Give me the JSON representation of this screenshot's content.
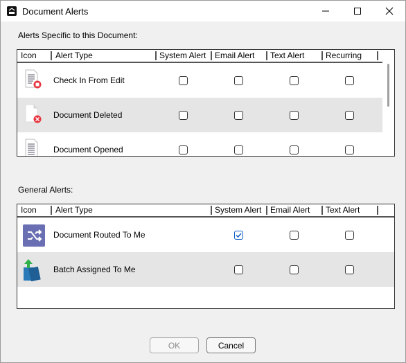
{
  "window": {
    "title": "Document Alerts",
    "icon": "spc-app-icon"
  },
  "specific": {
    "label": "Alerts Specific to this Document:",
    "columns": [
      "Icon",
      "Alert Type",
      "System Alert",
      "Email Alert",
      "Text Alert",
      "Recurring"
    ],
    "rows": [
      {
        "alert_type": "Check In From Edit",
        "icon": "document-error-icon",
        "system": false,
        "email": false,
        "text": false,
        "recurring": false
      },
      {
        "alert_type": "Document Deleted",
        "icon": "document-deleted-icon",
        "system": false,
        "email": false,
        "text": false,
        "recurring": false
      },
      {
        "alert_type": "Document Opened",
        "icon": "document-lines-icon",
        "system": false,
        "email": false,
        "text": false,
        "recurring": false
      }
    ]
  },
  "general": {
    "label": "General Alerts:",
    "columns": [
      "Icon",
      "Alert Type",
      "System Alert",
      "Email Alert",
      "Text Alert"
    ],
    "rows": [
      {
        "alert_type": "Document Routed To Me",
        "icon": "shuffle-route-icon",
        "system": true,
        "email": false,
        "text": false
      },
      {
        "alert_type": "Batch Assigned To Me",
        "icon": "batch-assign-icon",
        "system": false,
        "email": false,
        "text": false
      }
    ]
  },
  "buttons": {
    "ok": "OK",
    "cancel": "Cancel"
  },
  "colors": {
    "accent": "#0a5ac4",
    "route_icon": "#6a6fb3",
    "batch_icon": "#2a7ab8",
    "batch_arrow": "#2fb04a",
    "error_badge": "#e8323c"
  }
}
